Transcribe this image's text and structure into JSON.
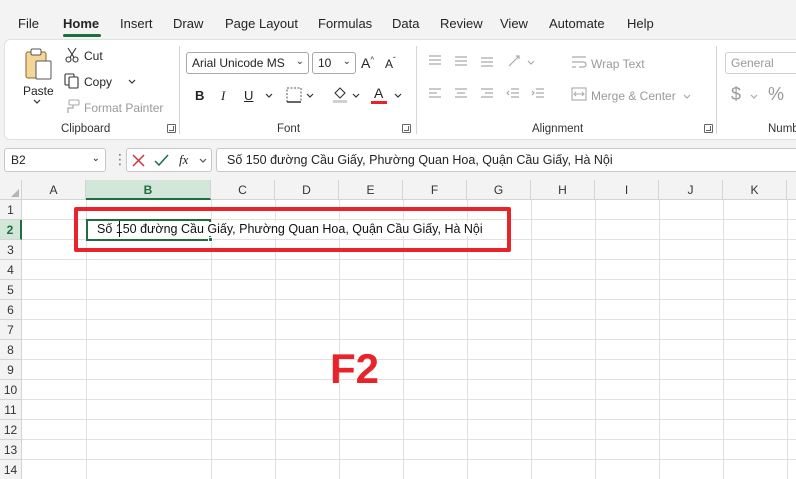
{
  "menu": {
    "items": [
      "File",
      "Home",
      "Insert",
      "Draw",
      "Page Layout",
      "Formulas",
      "Data",
      "Review",
      "View",
      "Automate",
      "Help"
    ],
    "active": "Home"
  },
  "ribbon": {
    "clipboard": {
      "label": "Clipboard",
      "paste": "Paste",
      "cut": "Cut",
      "copy": "Copy",
      "format_painter": "Format Painter"
    },
    "font": {
      "label": "Font",
      "font_name": "Arial Unicode MS",
      "font_size": "10",
      "bold": "B",
      "italic": "I",
      "underline": "U",
      "font_color": "#e8232a"
    },
    "alignment": {
      "label": "Alignment",
      "wrap_text": "Wrap Text",
      "merge_center": "Merge & Center"
    },
    "number": {
      "label": "Numb",
      "format": "General",
      "currency": "$",
      "percent": "%"
    }
  },
  "formula_bar": {
    "name_box": "B2",
    "fx": "fx",
    "content": "Số 150 đường Cầu Giấy, Phường Quan Hoa, Quận Cầu Giấy, Hà Nội"
  },
  "grid": {
    "columns": [
      "A",
      "B",
      "C",
      "D",
      "E",
      "F",
      "G",
      "H",
      "I",
      "J",
      "K"
    ],
    "rows": [
      "1",
      "2",
      "3",
      "4",
      "5",
      "6",
      "7",
      "8",
      "9",
      "10",
      "11",
      "12",
      "13",
      "14"
    ],
    "selected_column": "B",
    "selected_row": "2",
    "cell_b2": "Số 150 đường Cầu Giấy, Phường Quan Hoa, Quận Cầu Giấy, Hà Nội"
  },
  "annotation": {
    "text": "F2",
    "color": "#e8232a"
  },
  "colors": {
    "accent": "#1e6e42",
    "highlight": "#e8232a"
  }
}
